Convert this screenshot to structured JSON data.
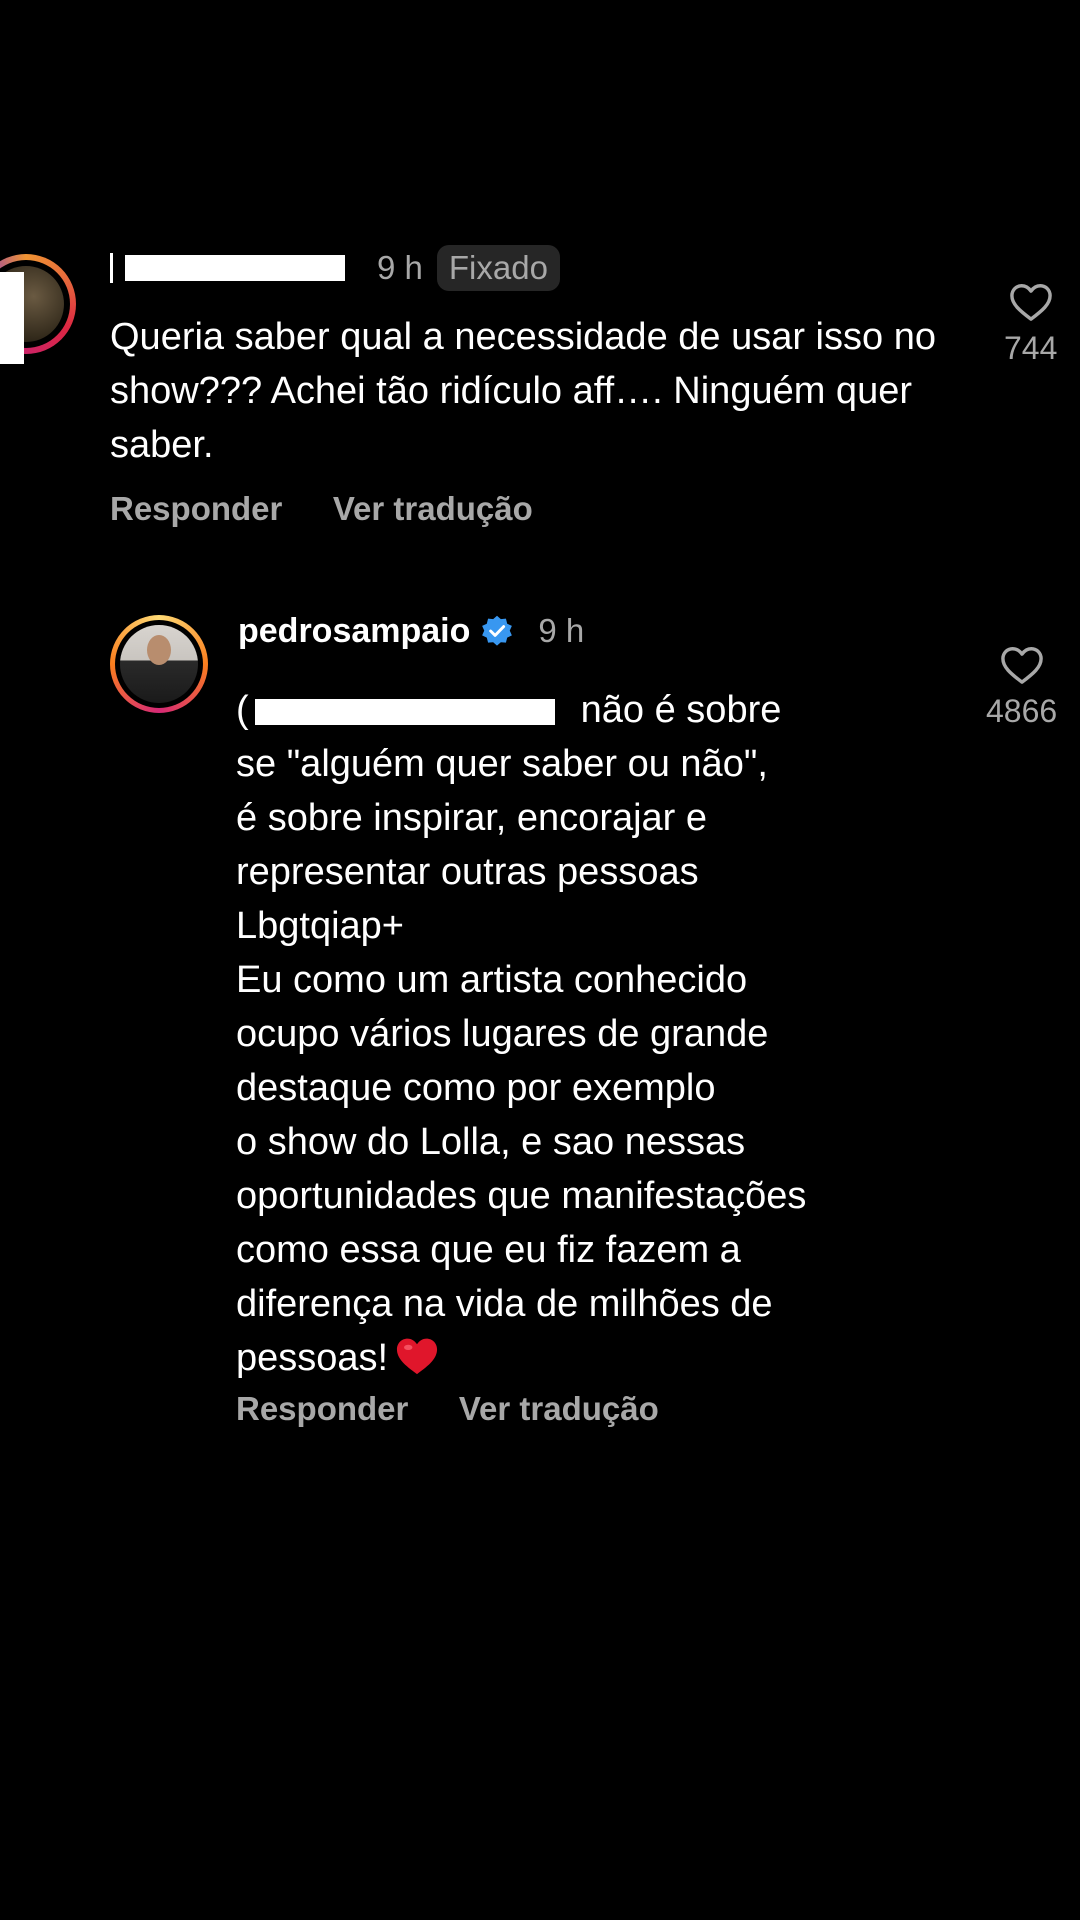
{
  "pinned_comment": {
    "username_prefix": "1",
    "time": "9 h",
    "badge": "Fixado",
    "text": "Queria saber qual a necessidade de usar isso no show??? Achei tão ridículo aff…. Ninguém quer saber.",
    "likes": "744",
    "actions": {
      "reply": "Responder",
      "translate": "Ver tradução"
    }
  },
  "reply": {
    "username": "pedrosampaio",
    "verified": true,
    "time": "9 h",
    "mention_prefix": "(",
    "text_lines": [
      "não é sobre",
      "se \"alguém quer saber ou não\",",
      "é sobre inspirar, encorajar e",
      "representar outras pessoas",
      "Lbgtqiap+",
      "Eu como um artista conhecido",
      "ocupo vários lugares de grande",
      "destaque como por exemplo",
      "o show do Lolla, e sao nessas",
      "oportunidades que manifestações",
      "como essa que eu fiz fazem a",
      "diferença na vida de milhões de",
      "pessoas!"
    ],
    "emoji": "red-heart",
    "likes": "4866",
    "actions": {
      "reply": "Responder",
      "translate": "Ver tradução"
    }
  },
  "colors": {
    "background": "#000000",
    "text": "#ffffff",
    "secondary_text": "#a8a8a8",
    "badge_bg": "#262626",
    "verified_blue": "#3897f0",
    "heart_red": "#e0162b"
  },
  "icons": [
    "heart-outline-icon",
    "verified-badge-icon",
    "red-heart-emoji"
  ]
}
